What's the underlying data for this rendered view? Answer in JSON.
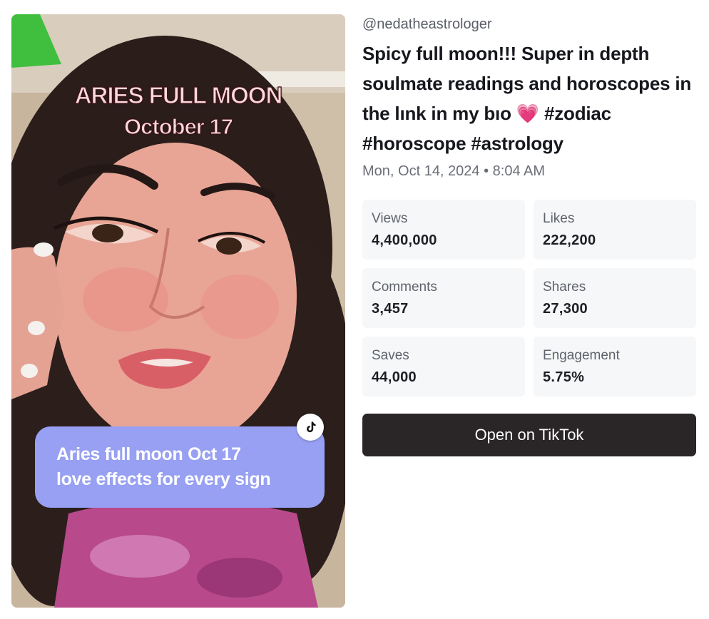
{
  "video": {
    "overlay_title_line1": "ARIES FULL MOON",
    "overlay_title_line2": "October 17",
    "caption_bubble_line1": "Aries full moon Oct 17",
    "caption_bubble_line2": "love effects for every sign",
    "badge_icon": "tiktok-logo-icon"
  },
  "post": {
    "handle": "@nedatheastrologer",
    "caption": "Spicy full moon!!! Super in depth soulmate readings and horoscopes in the lınk in my bıo 💗 #zodiac #horoscope #astrology",
    "date": "Mon, Oct 14, 2024 • 8:04 AM"
  },
  "stats": [
    {
      "label": "Views",
      "value": "4,400,000"
    },
    {
      "label": "Likes",
      "value": "222,200"
    },
    {
      "label": "Comments",
      "value": "3,457"
    },
    {
      "label": "Shares",
      "value": "27,300"
    },
    {
      "label": "Saves",
      "value": "44,000"
    },
    {
      "label": "Engagement",
      "value": "5.75%"
    }
  ],
  "actions": {
    "open_label": "Open on TikTok"
  },
  "colors": {
    "button_bg": "#2a2627",
    "bubble_bg": "#97a0f2",
    "stat_card_bg": "#f6f7f9"
  }
}
